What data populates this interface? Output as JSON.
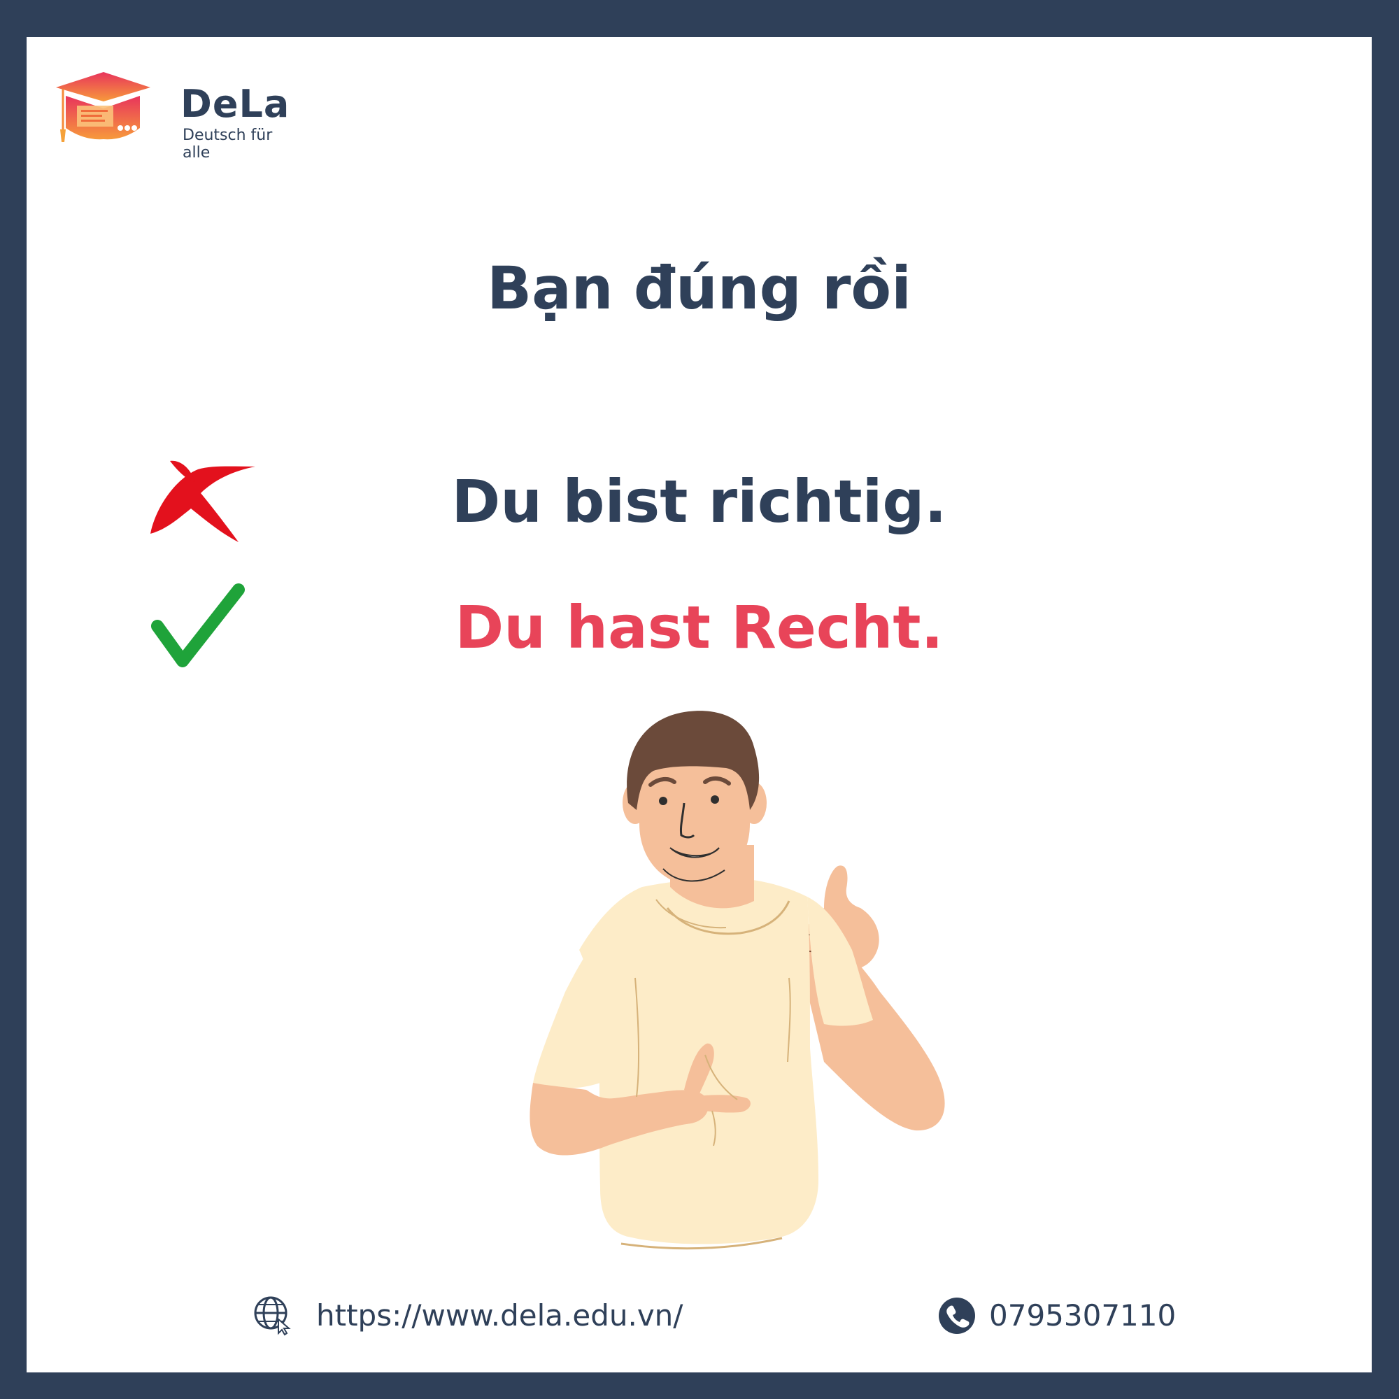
{
  "brand": {
    "name": "DeLa",
    "tagline": "Deutsch für alle"
  },
  "headline": "Bạn đúng rồi",
  "sentences": {
    "wrong": "Du bist richtig.",
    "right": "Du hast Recht."
  },
  "icons": {
    "wrong": "cross-icon",
    "right": "check-icon",
    "website": "globe-icon",
    "phone": "phone-icon"
  },
  "footer": {
    "website": "https://www.dela.edu.vn/",
    "phone": "0795307110"
  },
  "colors": {
    "frame": "#2f4059",
    "accent": "#e84459",
    "cross": "#e3111d",
    "check": "#1fa33a"
  }
}
